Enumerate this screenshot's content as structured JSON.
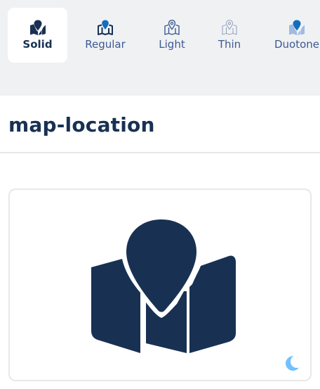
{
  "icon_name": "map-location",
  "tabs": [
    {
      "label": "Solid",
      "icon": "map-location-solid-icon",
      "active": true
    },
    {
      "label": "Regular",
      "icon": "map-location-regular-icon",
      "active": false
    },
    {
      "label": "Light",
      "icon": "map-location-light-icon",
      "active": false
    },
    {
      "label": "Thin",
      "icon": "map-location-thin-icon",
      "active": false
    },
    {
      "label": "Duotone",
      "icon": "map-location-duotone-icon",
      "active": false
    }
  ],
  "preview": {
    "icon": "map-location-icon",
    "theme_toggle_icon": "moon-icon"
  },
  "colors": {
    "navy": "#183153",
    "tab_label": "#3c5a93",
    "accent_blue": "#146ebe",
    "moon": "#74c0fc",
    "tab_bar_bg": "#f0f1f3"
  }
}
